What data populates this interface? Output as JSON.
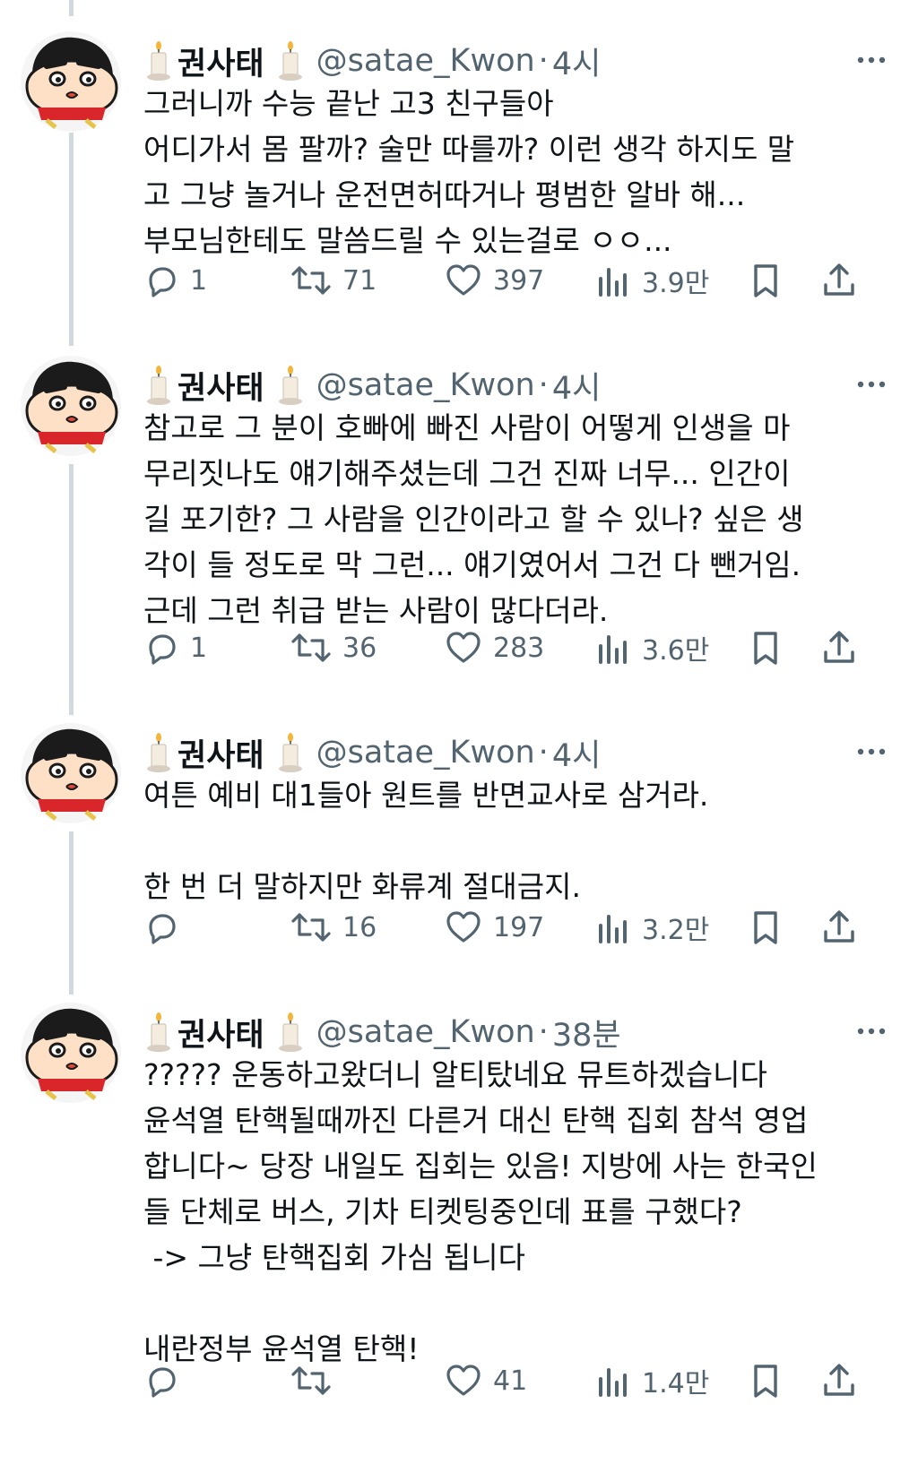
{
  "tweets": [
    {
      "name": "권사태",
      "handle": "@satae_Kwon",
      "separator": "·",
      "time": "4시",
      "text": "그러니까 수능 끝난 고3 친구들아\n어디가서 몸 팔까? 술만 따를까? 이런 생각 하지도 말\n고 그냥 놀거나 운전면허따거나 평범한 알바 해...\n부모님한테도 말씀드릴 수 있는걸로 ㅇㅇ...",
      "replies": "1",
      "retweets": "71",
      "likes": "397",
      "views": "3.9만"
    },
    {
      "name": "권사태",
      "handle": "@satae_Kwon",
      "separator": "·",
      "time": "4시",
      "text": "참고로 그 분이 호빠에 빠진 사람이 어떻게 인생을 마\n무리짓나도 얘기해주셨는데 그건 진짜 너무... 인간이\n길 포기한? 그 사람을 인간이라고 할 수 있나? 싶은 생\n각이 들 정도로 막 그런... 얘기였어서 그건 다 뺀거임.\n근데 그런 취급 받는 사람이 많다더라.",
      "replies": "1",
      "retweets": "36",
      "likes": "283",
      "views": "3.6만"
    },
    {
      "name": "권사태",
      "handle": "@satae_Kwon",
      "separator": "·",
      "time": "4시",
      "text": "여튼 예비 대1들아 원트를 반면교사로 삼거라.\n\n한 번 더 말하지만 화류계 절대금지.",
      "replies": "",
      "retweets": "16",
      "likes": "197",
      "views": "3.2만"
    },
    {
      "name": "권사태",
      "handle": "@satae_Kwon",
      "separator": "·",
      "time": "38분",
      "text": "????? 운동하고왔더니 알티탔네요 뮤트하겠습니다\n윤석열 탄핵될때까진 다른거 대신 탄핵 집회 참석 영업\n합니다~ 당장 내일도 집회는 있음! 지방에 사는 한국인\n들 단체로 버스, 기차 티켓팅중인데 표를 구했다?\n -> 그냥 탄핵집회 가심 됩니다\n\n내란정부 윤석열 탄핵!",
      "replies": "",
      "retweets": "",
      "likes": "41",
      "views": "1.4만"
    }
  ],
  "icons": {
    "avatar": "shinchan-avatar",
    "candle": "candle-emoji",
    "more": "more-icon",
    "reply": "reply-icon",
    "retweet": "retweet-icon",
    "like": "heart-icon",
    "views": "views-icon",
    "bookmark": "bookmark-icon",
    "share": "share-icon"
  },
  "colors": {
    "text": "#0f1419",
    "secondary": "#536471",
    "thread_line": "#cfd9de"
  }
}
